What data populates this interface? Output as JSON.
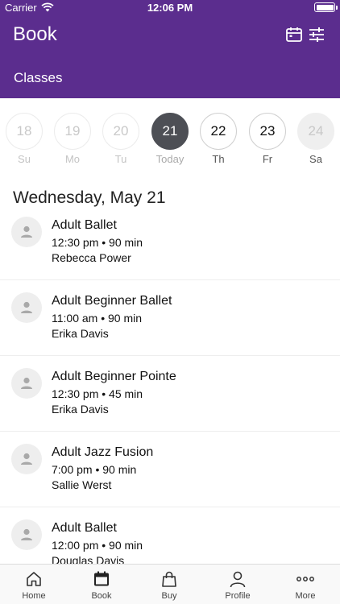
{
  "status_bar": {
    "carrier": "Carrier",
    "time": "12:06 PM"
  },
  "header": {
    "title": "Book",
    "subtitle": "Classes"
  },
  "week": [
    {
      "num": "18",
      "label": "Su",
      "state": "past"
    },
    {
      "num": "19",
      "label": "Mo",
      "state": "past"
    },
    {
      "num": "20",
      "label": "Tu",
      "state": "past"
    },
    {
      "num": "21",
      "label": "Today",
      "state": "selected"
    },
    {
      "num": "22",
      "label": "Th",
      "state": "future"
    },
    {
      "num": "23",
      "label": "Fr",
      "state": "future"
    },
    {
      "num": "24",
      "label": "Sa",
      "state": "disabled"
    }
  ],
  "date_heading": "Wednesday, May 21",
  "classes": [
    {
      "name": "Adult Ballet",
      "time": "12:30 pm • 90 min",
      "teacher": "Rebecca Power"
    },
    {
      "name": "Adult Beginner Ballet",
      "time": "11:00 am • 90 min",
      "teacher": "Erika Davis"
    },
    {
      "name": "Adult Beginner Pointe",
      "time": "12:30 pm • 45 min",
      "teacher": "Erika Davis"
    },
    {
      "name": "Adult Jazz Fusion",
      "time": "7:00 pm • 90 min",
      "teacher": "Sallie Werst"
    },
    {
      "name": "Adult Ballet",
      "time": "12:00 pm • 90 min",
      "teacher": "Douglas Davis"
    }
  ],
  "tabs": [
    {
      "label": "Home",
      "icon": "home-icon"
    },
    {
      "label": "Book",
      "icon": "calendar-icon"
    },
    {
      "label": "Buy",
      "icon": "shopping-bag-icon"
    },
    {
      "label": "Profile",
      "icon": "person-icon"
    },
    {
      "label": "More",
      "icon": "more-dots-icon"
    }
  ],
  "colors": {
    "brand": "#5b2d8e",
    "selected_day": "#4d4f55"
  }
}
